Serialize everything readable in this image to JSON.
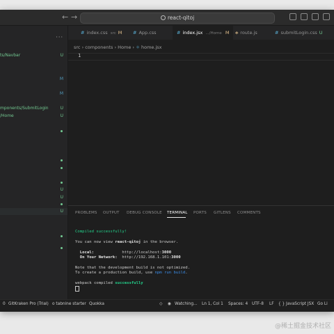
{
  "titlebar": {
    "back": "←",
    "forward": "→",
    "search": "react-qitoj"
  },
  "sidebar": {
    "menu": "···",
    "items": [
      {
        "label": "ts/Navbar",
        "status": "U"
      },
      {
        "label": "",
        "status": "M"
      },
      {
        "label": "",
        "status": "M"
      },
      {
        "label": "mponents/SubmitLogin",
        "status": "U"
      },
      {
        "label": "/Home",
        "status": "U"
      },
      {
        "label": "",
        "status": "U"
      },
      {
        "label": "",
        "status": "U"
      },
      {
        "label": "",
        "status": "U"
      },
      {
        "label": "",
        "status": "U"
      }
    ]
  },
  "tabs": [
    {
      "name": "index.css",
      "path": "src",
      "flag": "M"
    },
    {
      "name": "App.css",
      "path": "",
      "flag": ""
    },
    {
      "name": "index.jsx",
      "path": ".../Home",
      "flag": "M"
    },
    {
      "name": "route.js",
      "path": "",
      "flag": ""
    },
    {
      "name": "submitLogin.css",
      "path": "",
      "flag": "U"
    }
  ],
  "breadcrumbs": [
    "src",
    "components",
    "Home",
    "home.jsx"
  ],
  "editor": {
    "line_number": "1"
  },
  "panel": {
    "tabs": [
      "PROBLEMS",
      "OUTPUT",
      "DEBUG CONSOLE",
      "TERMINAL",
      "PORTS",
      "GITLENS",
      "COMMENTS"
    ],
    "terminal": {
      "compiled": "Compiled successfully!",
      "view_pre": "You can now view ",
      "app": "react-qitoj",
      "view_post": " in the browser.",
      "local_label": "  Local:",
      "local_url_pre": "http://localhost:",
      "local_port": "3000",
      "net_label": "  On Your Network:",
      "net_url_pre": "http://192.168.1.101:",
      "net_port": "3000",
      "note1": "Note that the development build is not optimized.",
      "note2_pre": "To create a production build, use ",
      "note2_cmd": "npm run build",
      "note2_post": ".",
      "webpack_pre": "webpack compiled ",
      "webpack_ok": "successfully"
    }
  },
  "statusbar": {
    "git_branch": "0",
    "gitkraken": "GitKraken Pro (Trial)",
    "tabnine": "o tabnine starter",
    "quokka": "Quokka",
    "watching": "Watching...",
    "position": "Ln 1, Col 1",
    "spaces": "Spaces: 4",
    "encoding": "UTF-8",
    "eol": "LF",
    "language": "JavaScript JSX",
    "golive": "Go Li"
  },
  "watermark": "@稀土掘金技术社区",
  "colors": {
    "modified": "#e2c08d",
    "untracked": "#73c991",
    "terminal_green": "#23d18b"
  }
}
